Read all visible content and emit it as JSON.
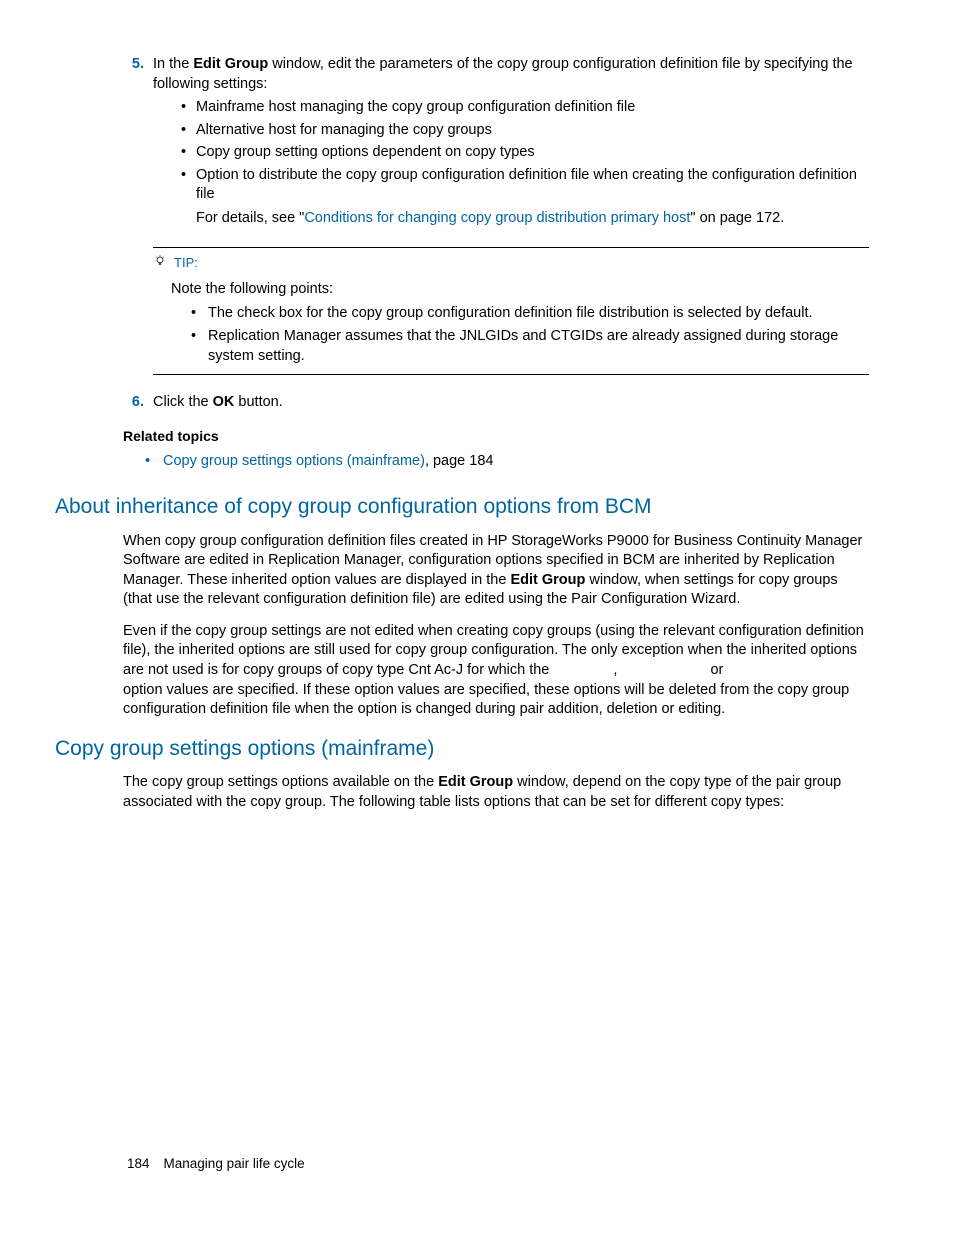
{
  "steps": {
    "five": {
      "num": "5.",
      "text_a": "In the ",
      "bold_a": "Edit Group",
      "text_b": " window, edit the parameters of the copy group configuration definition file by specifying the following settings:",
      "bullets": {
        "b1": "Mainframe host managing the copy group configuration definition file",
        "b2": "Alternative host for managing the copy groups",
        "b3": "Copy group setting options dependent on copy types",
        "b4": "Option to distribute the copy group configuration definition file when creating the configuration definition file",
        "b4_detail_a": "For details, see \"",
        "b4_link": "Conditions for changing copy group distribution primary host",
        "b4_detail_b": "\" on page 172."
      }
    },
    "six": {
      "num": "6.",
      "text_a": "Click the ",
      "bold_a": "OK",
      "text_b": " button."
    }
  },
  "tip": {
    "label": "TIP:",
    "intro": "Note the following points:",
    "p1": "The check box for the copy group configuration definition file distribution is selected by default.",
    "p2": "Replication Manager assumes that the JNLGIDs and CTGIDs are already assigned during storage system setting."
  },
  "related": {
    "heading": "Related topics",
    "link": "Copy group settings options (mainframe)",
    "page": ", page 184"
  },
  "section1": {
    "heading": "About inheritance of copy group configuration options from BCM",
    "p1_a": "When copy group configuration definition files created in HP StorageWorks P9000 for Business Continuity Manager Software are edited in Replication Manager, configuration options specified in BCM are inherited by Replication Manager. These inherited option values are displayed in the ",
    "p1_bold": "Edit Group",
    "p1_b": " window, when settings for copy groups (that use the relevant configuration definition file) are edited using the Pair Configuration Wizard.",
    "p2_a": "Even if the copy group settings are not edited when creating copy groups (using the relevant configuration definition file), the inherited options are still used for copy group configuration. The only exception when the inherited options are not used is for copy groups of copy type Cnt Ac-J for which the ",
    "p2_b": ", ",
    "p2_c": " or ",
    "p2_d": " option values are specified. If these option values are specified, these options will be deleted from the copy group configuration definition file when the option is changed during pair addition, deletion or editing."
  },
  "section2": {
    "heading": "Copy group settings options (mainframe)",
    "p1_a": "The copy group settings options available on the ",
    "p1_bold": "Edit Group",
    "p1_b": " window, depend on the copy type of the pair group associated with the copy group. The following table lists options that can be set for different copy types:"
  },
  "footer": {
    "page": "184",
    "title": "Managing pair life cycle"
  }
}
